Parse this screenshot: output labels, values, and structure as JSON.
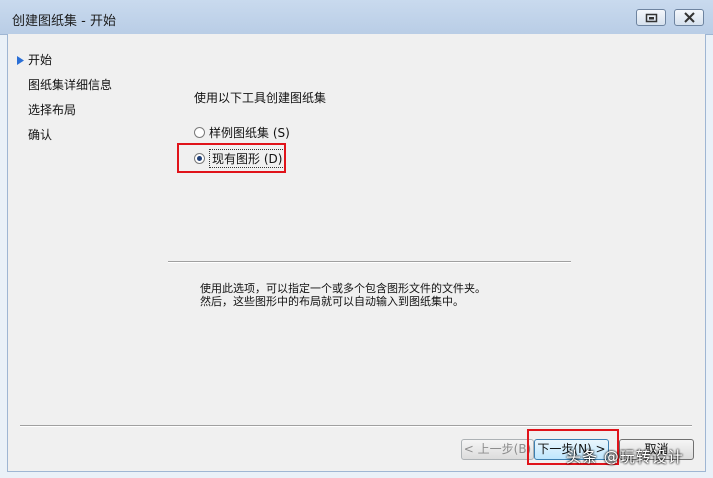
{
  "window": {
    "title": "创建图纸集 - 开始",
    "controls": [
      "restore-icon",
      "close-icon"
    ]
  },
  "nav": {
    "items": [
      {
        "label": "开始",
        "active": true
      },
      {
        "label": "图纸集详细信息",
        "active": false
      },
      {
        "label": "选择布局",
        "active": false
      },
      {
        "label": "确认",
        "active": false
      }
    ]
  },
  "main": {
    "heading": "使用以下工具创建图纸集",
    "options": [
      {
        "label": "样例图纸集 (S)",
        "checked": false
      },
      {
        "label": "现有图形 (D)",
        "checked": true
      }
    ],
    "description_line1": "使用此选项，可以指定一个或多个包含图形文件的文件夹。",
    "description_line2": "然后，这些图形中的布局就可以自动输入到图纸集中。"
  },
  "buttons": {
    "back": "< 上一步(B)",
    "next": "下一步(N) >",
    "cancel": "取消"
  },
  "watermark": "头条 @玩转设计",
  "colors": {
    "highlight": "#e0131a",
    "active_arrow": "#2a6fd6"
  }
}
